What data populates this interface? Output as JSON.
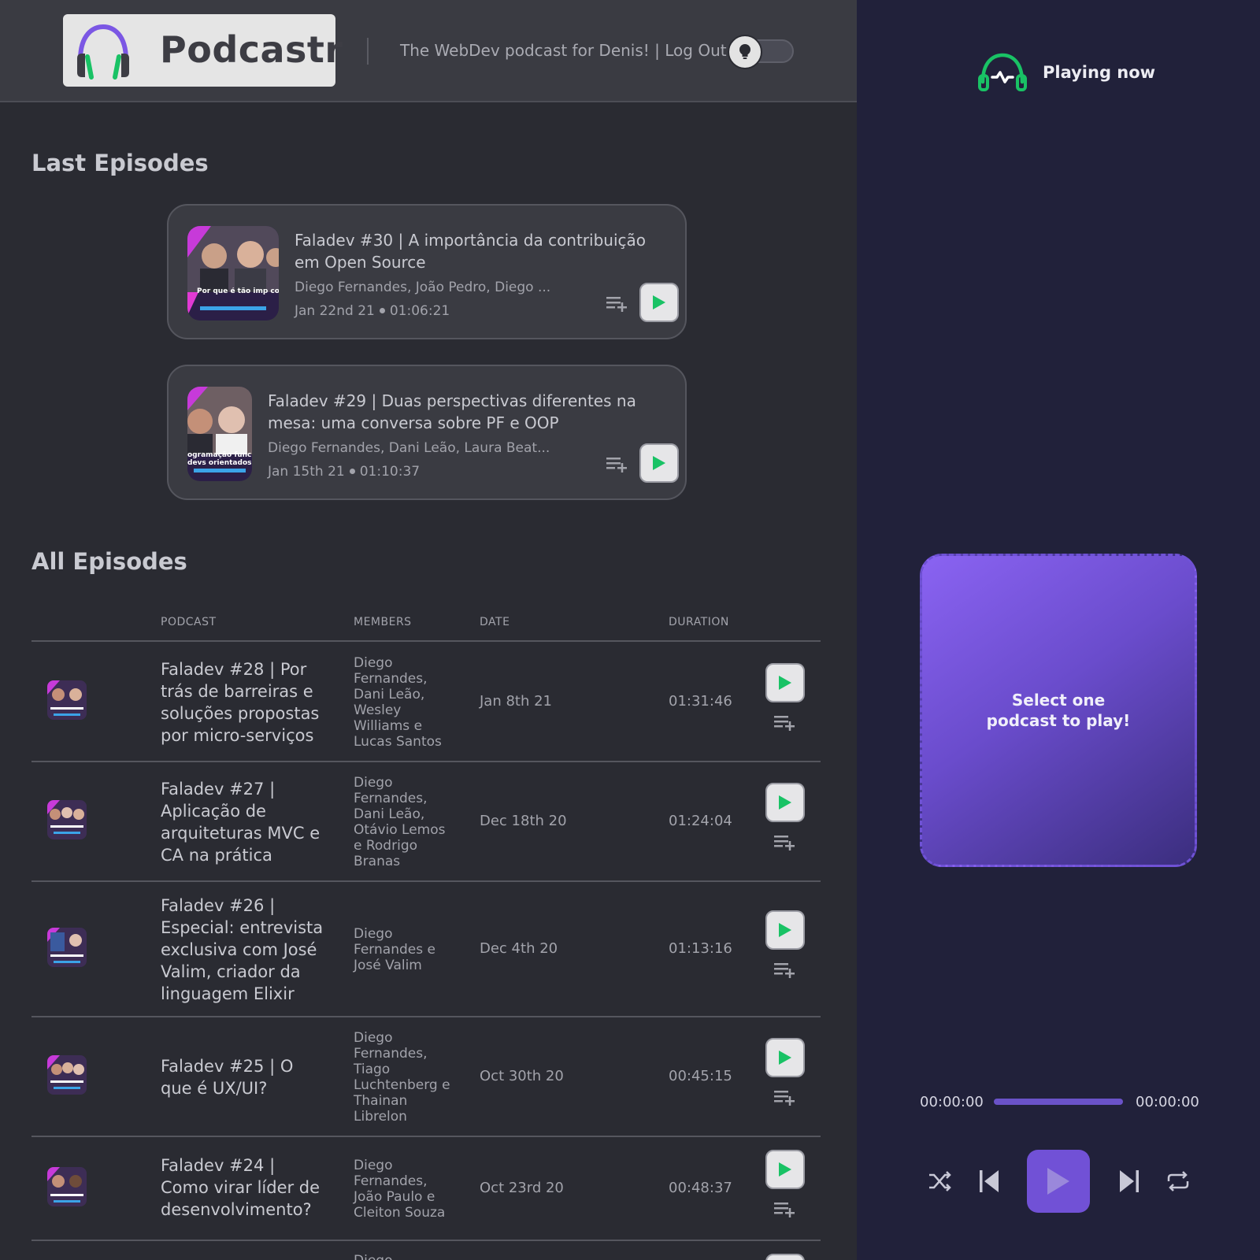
{
  "header": {
    "logo_text": "Podcastr",
    "tagline": "The WebDev podcast for Denis! | Log Out",
    "toggle_icon": "lightbulb-icon"
  },
  "colors": {
    "accent_green": "#19c265",
    "accent_purple": "#7151d6",
    "player_bg": "#21213a",
    "main_bg": "#2a2b32"
  },
  "last_episodes": {
    "title": "Last Episodes",
    "items": [
      {
        "title": "Faladev #30 | A importância da contribuição em Open Source",
        "members": "Diego Fernandes, João Pedro, Diego ...",
        "date": "Jan 22nd 21",
        "duration": "01:06:21",
        "thumb_caption": "Por que é tão imp contribuir em Open S"
      },
      {
        "title": "Faladev #29 | Duas perspectivas diferentes na mesa: uma conversa sobre PF e OOP",
        "members": "Diego Fernandes, Dani Leão, Laura Beat...",
        "date": "Jan 15th 21",
        "duration": "01:10:37",
        "thumb_caption": "ogramação func devs orientados"
      }
    ]
  },
  "all_episodes": {
    "title": "All Episodes",
    "columns": [
      "PODCAST",
      "MEMBERS",
      "DATE",
      "DURATION"
    ],
    "rows": [
      {
        "title": "Faladev #28 | Por trás de barreiras e soluções propostas por micro-serviços",
        "members": "Diego Fernandes, Dani Leão, Wesley Williams e Lucas Santos",
        "date": "Jan 8th 21",
        "duration": "01:31:46"
      },
      {
        "title": "Faladev #27 | Aplicação de arquiteturas MVC e CA na prática",
        "members": "Diego Fernandes, Dani Leão, Otávio Lemos e Rodrigo Branas",
        "date": "Dec 18th 20",
        "duration": "01:24:04"
      },
      {
        "title": "Faladev #26 | Especial: entrevista exclusiva com José Valim, criador da linguagem Elixir",
        "members": "Diego Fernandes e José Valim",
        "date": "Dec 4th 20",
        "duration": "01:13:16"
      },
      {
        "title": "Faladev #25 | O que é UX/UI?",
        "members": "Diego Fernandes, Tiago Luchtenberg e Thainan Librelon",
        "date": "Oct 30th 20",
        "duration": "00:45:15"
      },
      {
        "title": "Faladev #24 | Como virar líder de desenvolvimento?",
        "members": "Diego Fernandes, João Paulo e Cleiton Souza",
        "date": "Oct 23rd 20",
        "duration": "00:48:37"
      },
      {
        "title": "",
        "members": "Diego",
        "date": "",
        "duration": ""
      }
    ]
  },
  "player": {
    "heading": "Playing now",
    "empty_text": "Select one podcast to play!",
    "current_time": "00:00:00",
    "total_time": "00:00:00",
    "progress": 0,
    "controls": [
      "shuffle-icon",
      "previous-icon",
      "play-icon",
      "next-icon",
      "repeat-icon"
    ]
  }
}
